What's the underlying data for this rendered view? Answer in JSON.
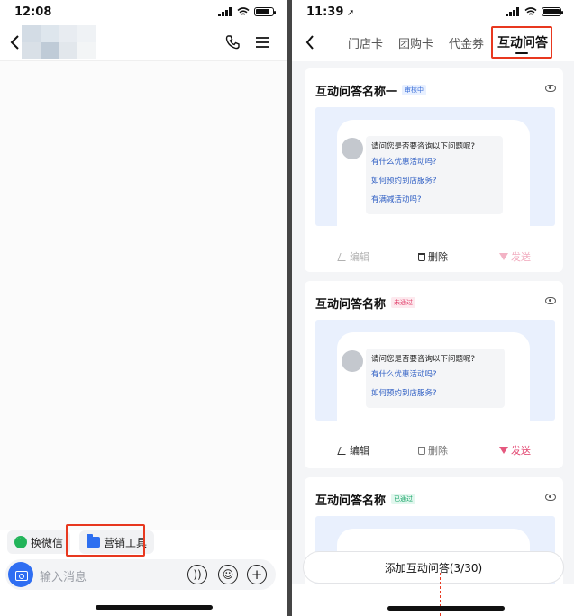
{
  "left_phone": {
    "status": {
      "time": "12:08"
    },
    "header": {
      "back_icon": "chevron-left-icon",
      "call_icon": "phone-icon",
      "menu_icon": "menu-icon"
    },
    "quick_tools": [
      {
        "label": "换微信",
        "icon": "wechat-icon"
      },
      {
        "label": "营销工具",
        "icon": "folder-icon"
      }
    ],
    "input": {
      "placeholder": "输入消息",
      "camera_icon": "camera-icon",
      "voice_icon": "voice-icon",
      "emoji_icon": "emoji-icon",
      "plus_icon": "plus-icon"
    }
  },
  "right_phone": {
    "status": {
      "time": "11:39"
    },
    "tabs": [
      {
        "label": "门店卡"
      },
      {
        "label": "团购卡"
      },
      {
        "label": "代金券"
      },
      {
        "label": "互动问答",
        "active": true
      }
    ],
    "cards": [
      {
        "title": "互动问答名称一",
        "status": "审核中",
        "question": "请问您是否要咨询以下问题呢?",
        "options": [
          "有什么优惠活动吗?",
          "如何预约到店服务?",
          "有满减活动吗?"
        ],
        "actions": {
          "edit": "编辑",
          "delete": "删除",
          "send": "发送"
        }
      },
      {
        "title": "互动问答名称",
        "status": "未通过",
        "question": "请问您是否要咨询以下问题呢?",
        "options": [
          "有什么优惠活动吗?",
          "如何预约到店服务?"
        ],
        "actions": {
          "edit": "编辑",
          "delete": "删除",
          "send": "发送"
        }
      },
      {
        "title": "互动问答名称",
        "status": "已通过"
      }
    ],
    "add_button": "添加互动问答(3/30)"
  },
  "colors": {
    "accent_blue": "#2f6ef2",
    "highlight_red": "#e8381f",
    "send_pink": "#e24670",
    "link_blue": "#2f5fc4"
  }
}
